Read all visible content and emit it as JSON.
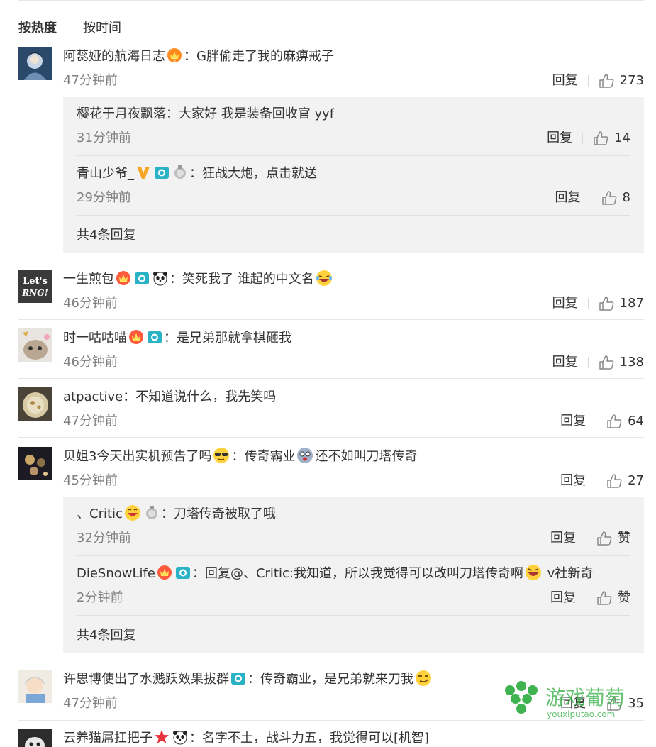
{
  "sort": {
    "hot": "按热度",
    "time": "按时间"
  },
  "actions": {
    "reply": "回复"
  },
  "comments": [
    {
      "nick": "阿蕊娅的航海日志",
      "text": "：G胖偷走了我的麻痹戒子",
      "time": "47分钟前",
      "likes": "273",
      "subreplies": [
        {
          "nick": "樱花于月夜飘落",
          "text": "：大家好 我是装备回收官 yyf",
          "time": "31分钟前",
          "likes": "14"
        },
        {
          "nick": "青山少爷_",
          "text": "：狂战大炮，点击就送",
          "time": "29分钟前",
          "likes": "8"
        }
      ],
      "more": "共4条回复"
    },
    {
      "nick": "一生煎包",
      "text": "：笑死我了 谁起的中文名",
      "time": "46分钟前",
      "likes": "187"
    },
    {
      "nick": "时一咕咕喵",
      "text": "：是兄弟那就拿棋砸我",
      "time": "46分钟前",
      "likes": "138"
    },
    {
      "nick": "atpactive",
      "text": "：不知道说什么，我先笑吗",
      "time": "47分钟前",
      "likes": "64"
    },
    {
      "nick": "贝姐3今天出实机预告了吗",
      "text": "：传奇霸业",
      "text2": "还不如叫刀塔传奇",
      "time": "45分钟前",
      "likes": "27",
      "subreplies": [
        {
          "nick": "、Critic",
          "text": "：刀塔传奇被取了哦",
          "time": "32分钟前",
          "likes": "赞"
        },
        {
          "nick": "DieSnowLife",
          "text": "：回复@、Critic:我知道，所以我觉得可以改叫刀塔传奇啊",
          "text2": " v社新奇",
          "time": "2分钟前",
          "likes": "赞"
        }
      ],
      "more": "共4条回复"
    },
    {
      "nick": "许思博使出了水溅跃效果拔群",
      "text": "：传奇霸业，是兄弟就来刀我",
      "time": "47分钟前",
      "likes": "35"
    },
    {
      "nick": "云养猫屌扛把子",
      "text": "：名字不土，战斗力五，我觉得可以[机智]"
    }
  ],
  "avatars": {
    "c2": "Let's RNG!"
  },
  "watermark": {
    "title": "游戏葡萄",
    "url": "youxiputao.com"
  },
  "colors": {
    "accent": "#3fb34f",
    "meta": "#808080",
    "box": "#f2f2f2",
    "rule": "#e6e6e6"
  }
}
